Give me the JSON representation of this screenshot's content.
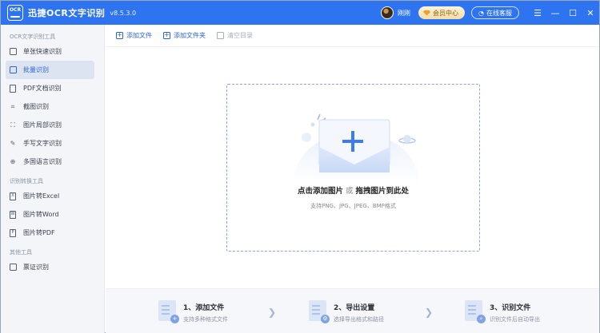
{
  "titlebar": {
    "logo_text": "OCR",
    "app_name": "迅捷OCR文字识别",
    "version": "v8.5.3.0",
    "username": "刚刚",
    "vip_label": "会员中心",
    "service_label": "在线客服",
    "menu_glyph": "☰",
    "minimize_glyph": "—",
    "maximize_glyph": "☐",
    "close_glyph": "✕"
  },
  "sidebar": {
    "groups": [
      {
        "title": "OCR文字识别工具",
        "items": [
          {
            "label": "单张快速识别",
            "icon": "image-icon"
          },
          {
            "label": "批量识别",
            "icon": "stack-icon",
            "active": true
          },
          {
            "label": "PDF文档识别",
            "icon": "pdf-icon"
          },
          {
            "label": "截图识别",
            "icon": "crop-icon"
          },
          {
            "label": "图片局部识别",
            "icon": "partial-select-icon"
          },
          {
            "label": "手写文字识别",
            "icon": "pen-icon"
          },
          {
            "label": "多国语言识别",
            "icon": "globe-icon"
          }
        ]
      },
      {
        "title": "识别转换工具",
        "items": [
          {
            "label": "图片转Excel",
            "icon": "excel-icon"
          },
          {
            "label": "图片转Word",
            "icon": "word-icon"
          },
          {
            "label": "图片转PDF",
            "icon": "pdf-file-icon"
          }
        ]
      },
      {
        "title": "其他工具",
        "items": [
          {
            "label": "票证识别",
            "icon": "ticket-icon"
          }
        ]
      }
    ]
  },
  "toolbar": {
    "add_file": "添加文件",
    "add_folder": "添加文件夹",
    "clear_list": "清空目录"
  },
  "dropzone": {
    "title_left": "点击添加图片",
    "title_or": "或",
    "title_right": "拖拽图片到此处",
    "formats": "支持PNG、JPG、JPEG、BMP格式"
  },
  "steps": [
    {
      "title": "1、添加文件",
      "desc": "支持多种格式文件"
    },
    {
      "title": "2、导出设置",
      "desc": "选择导出格式和路径"
    },
    {
      "title": "3、识别文件",
      "desc": "识别文件后自动导出"
    }
  ],
  "colors": {
    "brand_blue": "#2e73f0",
    "accent_blue": "#2e63d8",
    "sidebar_bg": "#f3f5f9",
    "dash_border": "#8aa8e0"
  }
}
